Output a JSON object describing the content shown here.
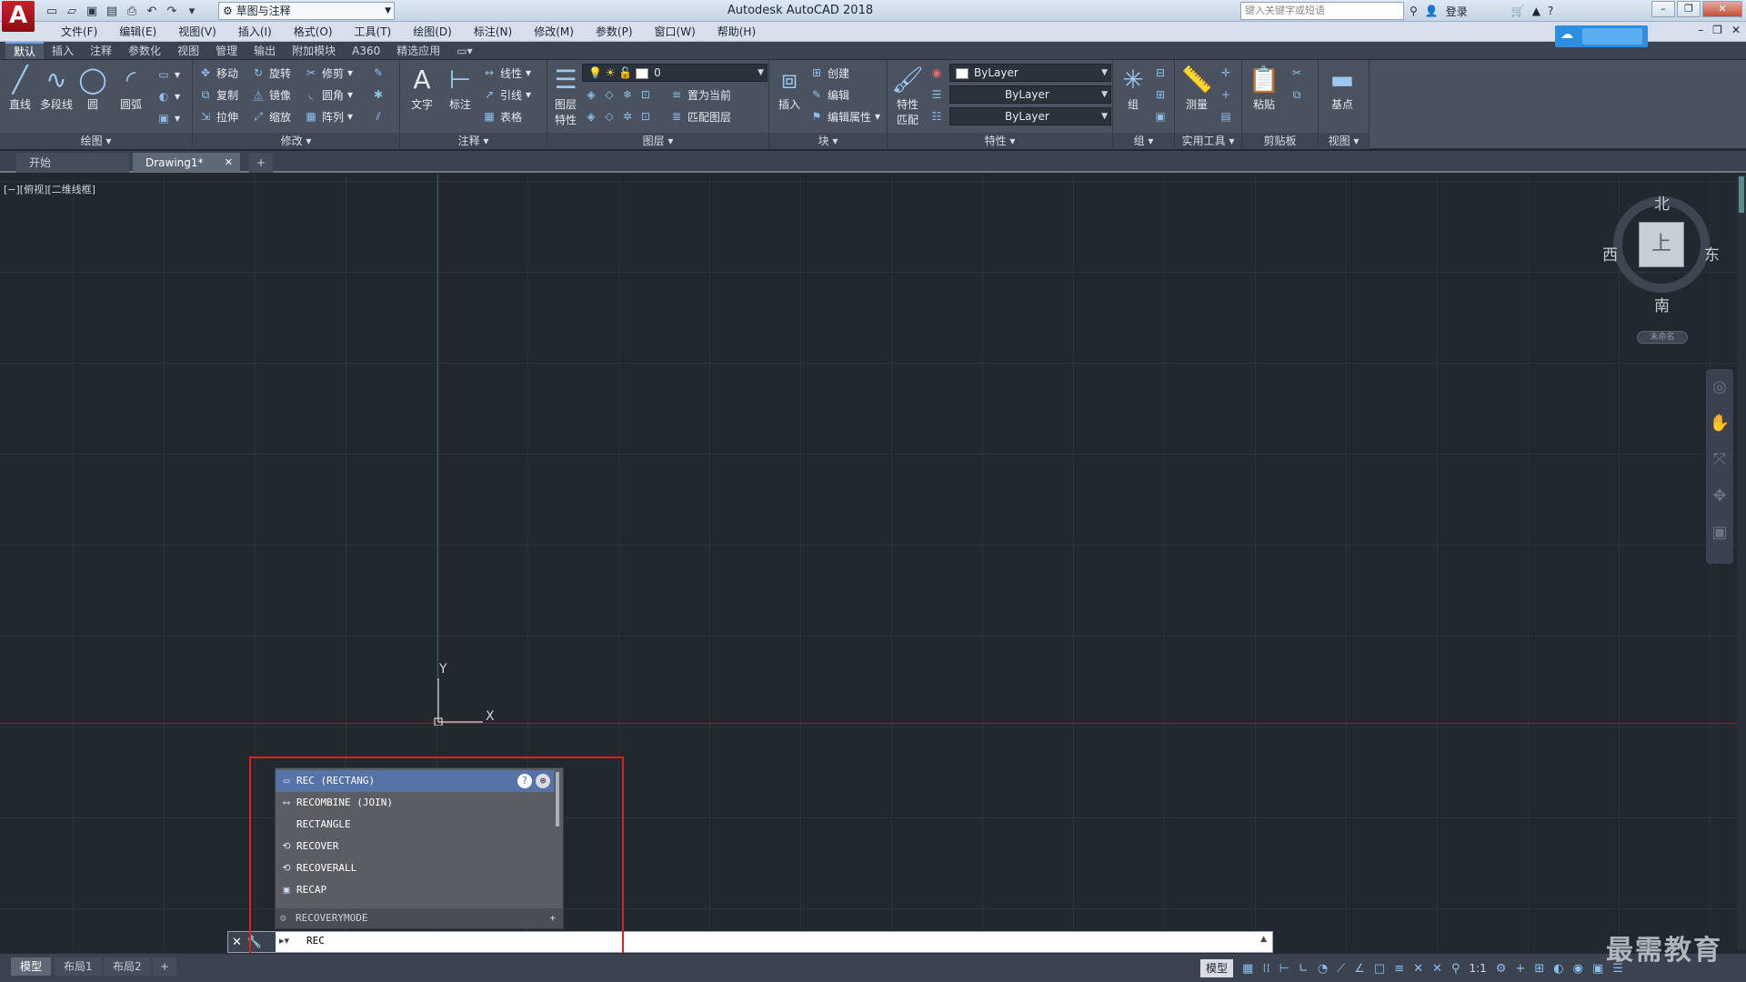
{
  "app": {
    "title": "Autodesk AutoCAD 2018",
    "logo_letter": "A",
    "workspace": "草图与注释",
    "search_placeholder": "键入关键字或短语",
    "login": "登录"
  },
  "menubar": [
    "文件(F)",
    "编辑(E)",
    "视图(V)",
    "插入(I)",
    "格式(O)",
    "工具(T)",
    "绘图(D)",
    "标注(N)",
    "修改(M)",
    "参数(P)",
    "窗口(W)",
    "帮助(H)"
  ],
  "ribbon_tabs": [
    "默认",
    "插入",
    "注释",
    "参数化",
    "视图",
    "管理",
    "输出",
    "附加模块",
    "A360",
    "精选应用"
  ],
  "ribbon": {
    "draw": {
      "title": "绘图",
      "line": "直线",
      "polyline": "多段线",
      "circle": "圆",
      "arc": "圆弧"
    },
    "modify": {
      "title": "修改",
      "move": "移动",
      "rotate": "旋转",
      "trim": "修剪",
      "copy": "复制",
      "mirror": "镜像",
      "fillet": "圆角",
      "stretch": "拉伸",
      "scale": "缩放",
      "array": "阵列"
    },
    "annotation": {
      "title": "注释",
      "text": "文字",
      "dimension": "标注",
      "linear": "线性",
      "leader": "引线",
      "table": "表格"
    },
    "layers": {
      "title": "图层",
      "props1": "图层",
      "props2": "特性",
      "current_layer": "0",
      "make_current": "置为当前",
      "match_layer": "匹配图层"
    },
    "block": {
      "title": "块",
      "insert": "插入",
      "create": "创建",
      "edit": "编辑",
      "edit_attr": "编辑属性"
    },
    "properties": {
      "title": "特性",
      "match1": "特性",
      "match2": "匹配",
      "color": "ByLayer",
      "linetype": "ByLayer",
      "lineweight": "ByLayer"
    },
    "groups": {
      "title": "组",
      "group": "组"
    },
    "utilities": {
      "title": "实用工具",
      "measure": "测量"
    },
    "clipboard": {
      "title": "剪贴板",
      "paste": "粘贴"
    },
    "view": {
      "title": "视图",
      "base": "基点"
    }
  },
  "file_tabs": {
    "start": "开始",
    "drawing": "Drawing1*"
  },
  "viewport_controls": "[−][俯视][二维线框]",
  "ucs": {
    "x": "X",
    "y": "Y"
  },
  "viewcube": {
    "north": "北",
    "south": "南",
    "east": "东",
    "west": "西",
    "top": "上",
    "named": "未命名"
  },
  "autocomplete": {
    "items": [
      {
        "label": "REC (RECTANG)",
        "icon": "rectangle-icon"
      },
      {
        "label": "RECOMBINE (JOIN)",
        "icon": "join-icon"
      },
      {
        "label": "RECTANGLE",
        "icon": ""
      },
      {
        "label": "RECOVER",
        "icon": "recover-icon"
      },
      {
        "label": "RECOVERALL",
        "icon": "recoverall-icon"
      },
      {
        "label": "RECAP",
        "icon": "recap-icon"
      }
    ],
    "footer": "RECOVERYMODE"
  },
  "command_line": {
    "input": "REC"
  },
  "layout_tabs": [
    "模型",
    "布局1",
    "布局2"
  ],
  "status": {
    "model": "模型",
    "scale": "1:1"
  },
  "watermark": "最需教育",
  "colors": {
    "accent": "#2c8ee0",
    "highlight_box": "#e02020",
    "selection": "#5673a8"
  }
}
